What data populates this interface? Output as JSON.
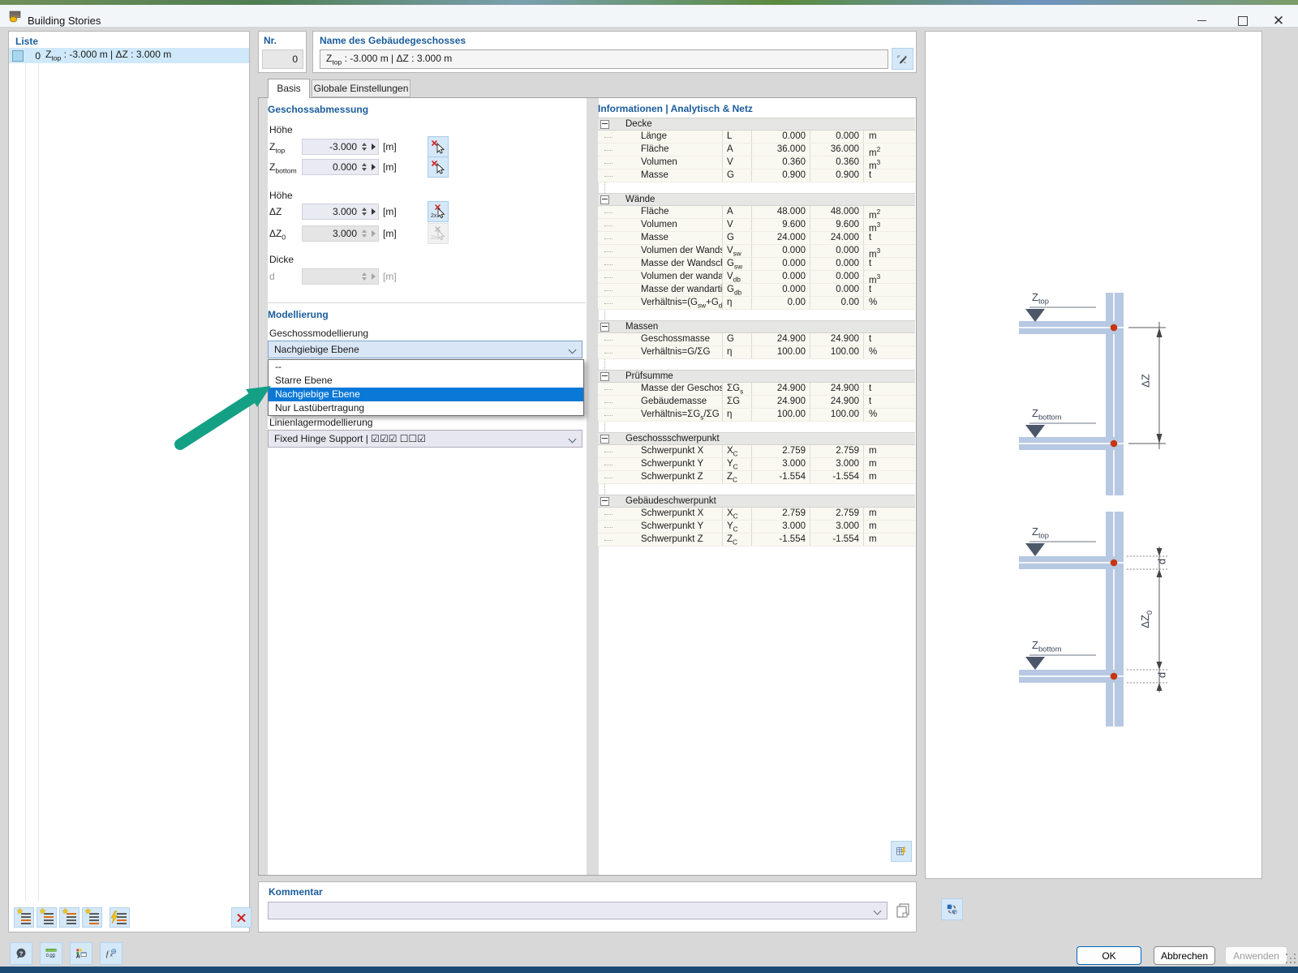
{
  "window": {
    "title": "Building Stories"
  },
  "list_panel": {
    "title": "Liste",
    "items": [
      {
        "color": "#a8d7ee",
        "nr": "0",
        "label_html": "Z<sub>top</sub> : -3.000 m | ΔZ : 3.000 m",
        "selected": true
      }
    ],
    "toolbar": [
      "new-story-first",
      "new-story-above",
      "new-story-below",
      "new-story-last",
      "generate-stories",
      "delete-story"
    ]
  },
  "header": {
    "nr_label": "Nr.",
    "nr_value": "0",
    "name_label": "Name des Gebäudegeschosses",
    "name_value_html": "Z<sub>top</sub> : -3.000 m | ΔZ : 3.000 m"
  },
  "tabs": [
    {
      "label": "Basis",
      "active": true
    },
    {
      "label": "Globale Einstellungen",
      "active": false
    }
  ],
  "geschossabmessung": {
    "title": "Geschossabmessung",
    "group1": "Höhe",
    "group2": "Höhe",
    "group3": "Dicke",
    "fields": [
      {
        "label_html": "Z<sub>top</sub>",
        "value": "-3.000",
        "unit": "[m]",
        "disabled": false
      },
      {
        "label_html": "Z<sub>bottom</sub>",
        "value": "0.000",
        "unit": "[m]",
        "disabled": false
      },
      {
        "label_html": "ΔZ",
        "value": "3.000",
        "unit": "[m]",
        "disabled": false
      },
      {
        "label_html": "ΔZ<sub>0</sub>",
        "value": "3.000",
        "unit": "[m]",
        "disabled": true
      },
      {
        "label_html": "d",
        "value": "",
        "unit": "[m]",
        "disabled": true
      }
    ]
  },
  "modellierung": {
    "title": "Modellierung",
    "story_label": "Geschossmodellierung",
    "story_value": "Nachgiebige Ebene",
    "dropdown_options": [
      "--",
      "Starre Ebene",
      "Nachgiebige Ebene",
      "Nur Lastübertragung"
    ],
    "dropdown_selected_index": 2,
    "support_label": "Linienlagermodellierung",
    "support_value": "Fixed Hinge Support | ☑☑☑ ☐☐☑"
  },
  "info_table": {
    "title": "Informationen | Analytisch & Netz",
    "groups": [
      {
        "name": "Decke",
        "rows": [
          [
            "Länge",
            "L",
            "0.000",
            "0.000",
            "m"
          ],
          [
            "Fläche",
            "A",
            "36.000",
            "36.000",
            "m<sup>2</sup>"
          ],
          [
            "Volumen",
            "V",
            "0.360",
            "0.360",
            "m<sup>3</sup>"
          ],
          [
            "Masse",
            "G",
            "0.900",
            "0.900",
            "t"
          ]
        ]
      },
      {
        "name": "Wände",
        "rows": [
          [
            "Fläche",
            "A",
            "48.000",
            "48.000",
            "m<sup>2</sup>"
          ],
          [
            "Volumen",
            "V",
            "9.600",
            "9.600",
            "m<sup>3</sup>"
          ],
          [
            "Masse",
            "G",
            "24.000",
            "24.000",
            "t"
          ],
          [
            "Volumen der Wands...",
            "V<sub>sw</sub>",
            "0.000",
            "0.000",
            "m<sup>3</sup>"
          ],
          [
            "Masse der Wandsch...",
            "G<sub>sw</sub>",
            "0.000",
            "0.000",
            "t"
          ],
          [
            "Volumen der wanda...",
            "V<sub>db</sub>",
            "0.000",
            "0.000",
            "m<sup>3</sup>"
          ],
          [
            "Masse der wandarti...",
            "G<sub>db</sub>",
            "0.000",
            "0.000",
            "t"
          ],
          [
            "Verhältnis=(G<sub>sw</sub>+G<sub>dl</sub>···",
            "η",
            "0.00",
            "0.00",
            "%"
          ]
        ]
      },
      {
        "name": "Massen",
        "rows": [
          [
            "Geschossmasse",
            "G",
            "24.900",
            "24.900",
            "t"
          ],
          [
            "Verhältnis=G/ΣG",
            "η",
            "100.00",
            "100.00",
            "%"
          ]
        ]
      },
      {
        "name": "Prüfsumme",
        "rows": [
          [
            "Masse der Geschosse",
            "ΣG<sub>s</sub>",
            "24.900",
            "24.900",
            "t"
          ],
          [
            "Gebäudemasse",
            "ΣG",
            "24.900",
            "24.900",
            "t"
          ],
          [
            "Verhältnis=ΣG<sub>s</sub>/ΣG",
            "η",
            "100.00",
            "100.00",
            "%"
          ]
        ]
      },
      {
        "name": "Geschossschwerpunkt",
        "rows": [
          [
            "Schwerpunkt X",
            "X<sub>C</sub>",
            "2.759",
            "2.759",
            "m"
          ],
          [
            "Schwerpunkt Y",
            "Y<sub>C</sub>",
            "3.000",
            "3.000",
            "m"
          ],
          [
            "Schwerpunkt Z",
            "Z<sub>C</sub>",
            "-1.554",
            "-1.554",
            "m"
          ]
        ]
      },
      {
        "name": "Gebäudeschwerpunkt",
        "rows": [
          [
            "Schwerpunkt X",
            "X<sub>C</sub>",
            "2.759",
            "2.759",
            "m"
          ],
          [
            "Schwerpunkt Y",
            "Y<sub>C</sub>",
            "3.000",
            "3.000",
            "m"
          ],
          [
            "Schwerpunkt Z",
            "Z<sub>C</sub>",
            "-1.554",
            "-1.554",
            "m"
          ]
        ]
      }
    ]
  },
  "kommentar": {
    "label": "Kommentar",
    "value": ""
  },
  "diagram": {
    "top": {
      "ztop_html": "Z<sub>top</sub>",
      "zbottom_html": "Z<sub>bottom</sub>",
      "dim_html": "ΔZ"
    },
    "bottom": {
      "ztop_html": "Z<sub>top</sub>",
      "zbottom_html": "Z<sub>bottom</sub>",
      "dim_html": "ΔZ<sub>0</sub>",
      "d1_html": "d",
      "d2_html": "d"
    }
  },
  "footer": {
    "ok": "OK",
    "cancel": "Abbrechen",
    "apply": "Anwenden"
  },
  "icons": {
    "app_icon": "building-stories",
    "minimize_icon": "–",
    "maximize_icon": "□",
    "close_icon": "×",
    "rename_icon": "pencil",
    "pick_icon": "cursor-with-red-x",
    "pick_twice_icon": "cursor-with-red-x-2x",
    "spin_icons": "▲▼▶",
    "chevron_icon": "v",
    "expander_icon": "−",
    "edit_in_table_icon": "table-lightning",
    "copy_icon": "pages",
    "view_toggle_icon": "2d-3d-switch",
    "delete_icon": "red-x",
    "new_story_icon": "list-star",
    "generate_icon": "list-lightning",
    "help_icon": "?",
    "units_icon": "0.00",
    "display_settings_icon": "A-colors",
    "formula_icon": "fx",
    "story_marker_icon": "▼",
    "node_icon": "red-dot"
  },
  "colors": {
    "accent_blue": "#1b5c9b",
    "selection": "#0a78d7",
    "list_selection": "#cfe9fa",
    "icon_button_bg": "#d5e8f8",
    "arrow_green": "#14a085",
    "slab": "#b7c8e2",
    "node_red": "#c63612"
  }
}
